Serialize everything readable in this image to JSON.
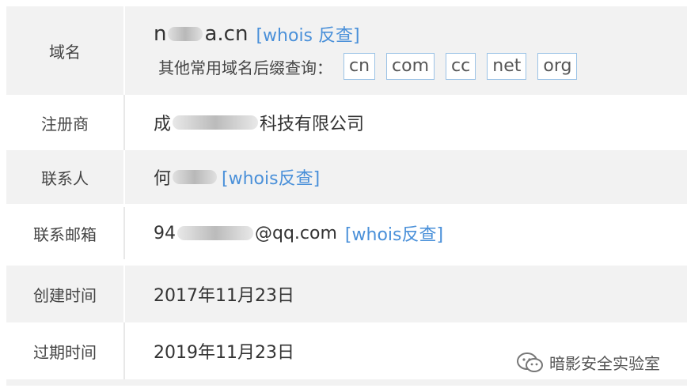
{
  "rows": [
    {
      "label": "域名",
      "domain_prefix": "n",
      "domain_suffix": "a.cn",
      "whois_link": "[whois 反查]",
      "suffix_prompt": "其他常用域名后缀查询：",
      "suffixes": [
        "cn",
        "com",
        "cc",
        "net",
        "org"
      ]
    },
    {
      "label": "注册商",
      "value_prefix": "成",
      "value_suffix": "科技有限公司"
    },
    {
      "label": "联系人",
      "value_prefix": "何",
      "whois_link": "[whois反查]"
    },
    {
      "label": "联系邮箱",
      "value_prefix": "94",
      "value_suffix": "@qq.com",
      "whois_link": "[whois反查]"
    },
    {
      "label": "创建时间",
      "value": "2017年11月23日"
    },
    {
      "label": "过期时间",
      "value": "2019年11月23日"
    }
  ],
  "watermark": {
    "text": "暗影安全实验室",
    "icon": "wechat-icon"
  }
}
